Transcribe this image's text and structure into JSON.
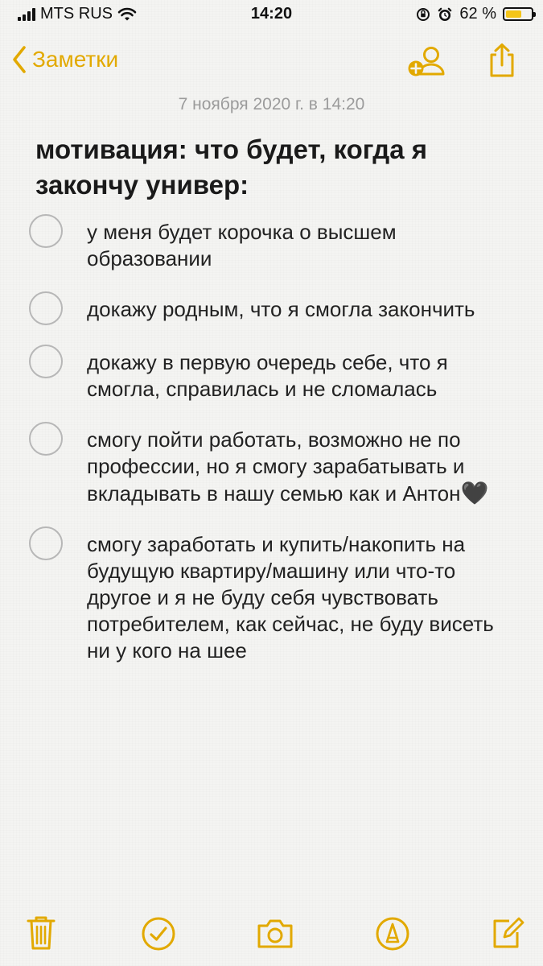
{
  "status_bar": {
    "carrier": "MTS RUS",
    "time": "14:20",
    "battery_text": "62 %",
    "battery_level_percent": 62
  },
  "nav": {
    "back_label": "Заметки"
  },
  "note": {
    "date": "7 ноября 2020 г. в 14:20",
    "title": "мотивация: что будет, когда я закончу универ:",
    "items": [
      "у меня будет корочка о высшем образовании",
      "докажу родным, что я смогла закончить",
      "докажу в первую очередь себе, что я смогла, справилась и не сломалась",
      "смогу пойти работать, возможно не по профессии, но я смогу зарабатывать и вкладывать в нашу семью как и Антон",
      "смогу заработать и купить/накопить на будущую квартиру/машину или что-то другое и я не буду себя чувствовать потребителем, как сейчас, не буду висеть ни у кого на шее"
    ],
    "emoji_heart": "🖤"
  },
  "colors": {
    "accent": "#e2a900",
    "background": "#f4f4f2",
    "date_text": "#9b9b9b",
    "checkbox_border": "#b7b7b7"
  },
  "icons": {
    "back": "chevron-left-icon",
    "add_people": "add-person-icon",
    "share": "share-icon",
    "trash": "trash-icon",
    "checklist": "checkmark-circle-icon",
    "camera": "camera-icon",
    "markup": "markup-pen-icon",
    "compose": "compose-icon"
  }
}
